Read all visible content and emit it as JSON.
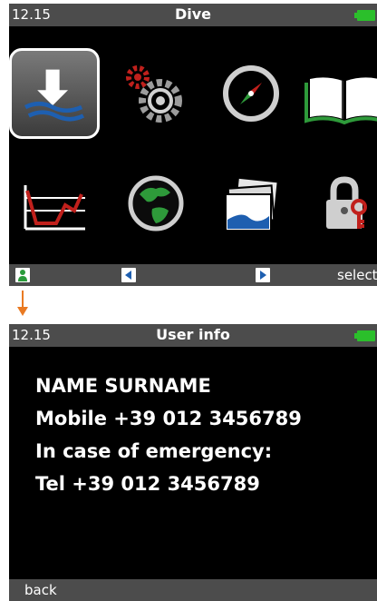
{
  "top_screen": {
    "status": {
      "time": "12.15",
      "title": "Dive"
    },
    "menu_icons": [
      "dive-mode-icon",
      "settings-gears-icon",
      "compass-icon",
      "logbook-icon",
      "dive-profile-chart-icon",
      "globe-icon",
      "photo-gallery-icon",
      "padlock-icon"
    ],
    "selected_icon": "dive-mode-icon",
    "softkeys": {
      "right_label": "select"
    }
  },
  "bottom_screen": {
    "status": {
      "time": "12.15",
      "title": "User info"
    },
    "lines": [
      "NAME SURNAME",
      "Mobile +39 012 3456789",
      "In case of emergency:",
      "Tel +39 012 3456789"
    ],
    "softkeys": {
      "left_label": "back"
    }
  },
  "colors": {
    "bar_gray": "#4c4c4c",
    "battery_green": "#2bbf2b",
    "softkey_blue": "#1e5fb0",
    "softkey_green": "#2a9b3a",
    "connector_orange": "#e97a22",
    "gear_red": "#c0201c",
    "chart_red": "#c0201c",
    "book_green": "#2e9a3a",
    "key_red": "#c0201c"
  }
}
